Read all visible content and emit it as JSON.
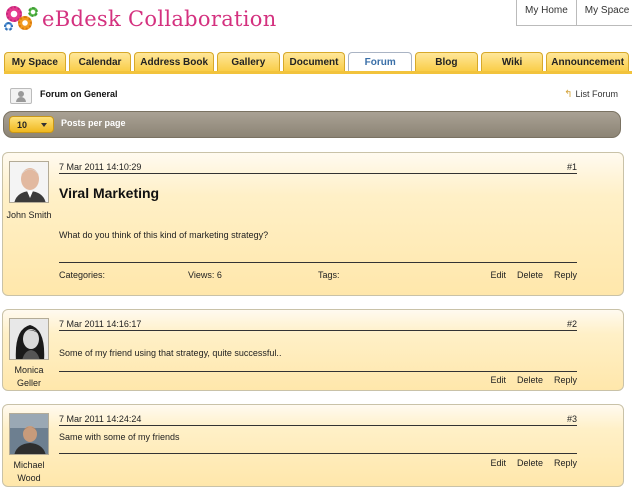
{
  "app": {
    "logo_text": "eBdesk Collaboration"
  },
  "topnav": {
    "items": [
      "My Home",
      "My Space"
    ]
  },
  "tabs": [
    "My Space",
    "Calendar",
    "Address Book",
    "Gallery",
    "Document",
    "Forum",
    "Blog",
    "Wiki",
    "Announcement"
  ],
  "active_tab": "Forum",
  "forum": {
    "title": "Forum on General",
    "list_link": "List Forum"
  },
  "toolbar": {
    "per_page_value": "10",
    "per_page_label": "Posts per page"
  },
  "posts": [
    {
      "author": "John Smith",
      "date": "7 Mar 2011 14:10:29",
      "number": "#1",
      "title": "Viral Marketing",
      "body": "What do you think of this kind of marketing strategy?",
      "categories_label": "Categories:",
      "views_label": "Views: 6",
      "tags_label": "Tags:"
    },
    {
      "author": "Monica Geller",
      "date": "7 Mar 2011 14:16:17",
      "number": "#2",
      "body": "Some of my friend using that strategy, quite successful.."
    },
    {
      "author": "Michael Wood",
      "date": "7 Mar 2011 14:24:24",
      "number": "#3",
      "body": "Same with some of my friends"
    }
  ],
  "actions": {
    "edit": "Edit",
    "delete": "Delete",
    "reply": "Reply"
  },
  "colors": {
    "tab": "#f9cc44",
    "active_tab_text": "#3a6fa8",
    "logo": "#d4317f",
    "post_bg": "#ffe7ab"
  },
  "icons": [
    "gears-logo-icon",
    "user-forum-icon",
    "back-arrow-icon",
    "dropdown-caret-icon"
  ]
}
